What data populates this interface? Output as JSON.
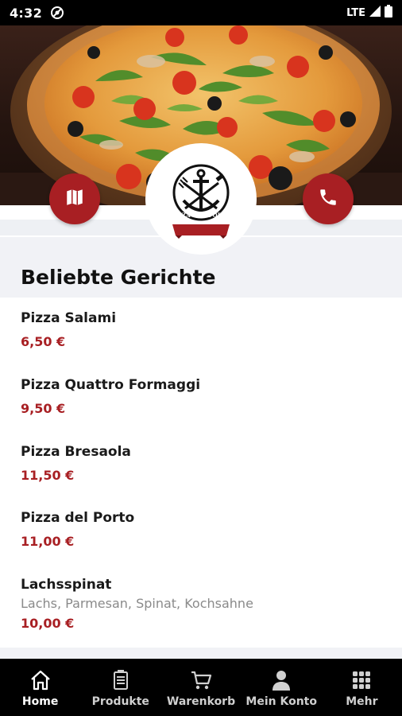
{
  "status_bar": {
    "time": "4:32",
    "network": "LTE"
  },
  "hero": {
    "map_icon": "map-icon",
    "phone_icon": "phone-icon"
  },
  "logo": {
    "icon": "anchor-cutlery-icon",
    "text": "PIZZA DEL PORTO"
  },
  "section": {
    "title": "Beliebte Gerichte"
  },
  "items": [
    {
      "name": "Pizza Salami",
      "price": "6,50 €"
    },
    {
      "name": "Pizza Quattro Formaggi",
      "price": "9,50 €"
    },
    {
      "name": "Pizza Bresaola",
      "price": "11,50 €"
    },
    {
      "name": "Pizza del Porto",
      "price": "11,00 €"
    },
    {
      "name": "Lachsspinat",
      "description": "Lachs, Parmesan, Spinat, Kochsahne",
      "price": "10,00 €"
    }
  ],
  "nav": [
    {
      "label": "Home",
      "icon": "home-icon",
      "active": true
    },
    {
      "label": "Produkte",
      "icon": "menu-book-icon",
      "active": false
    },
    {
      "label": "Warenkorb",
      "icon": "cart-icon",
      "active": false
    },
    {
      "label": "Mein Konto",
      "icon": "person-icon",
      "active": false
    },
    {
      "label": "Mehr",
      "icon": "grid-icon",
      "active": false
    }
  ],
  "colors": {
    "accent": "#a81f23",
    "nav_bg": "#000000"
  }
}
